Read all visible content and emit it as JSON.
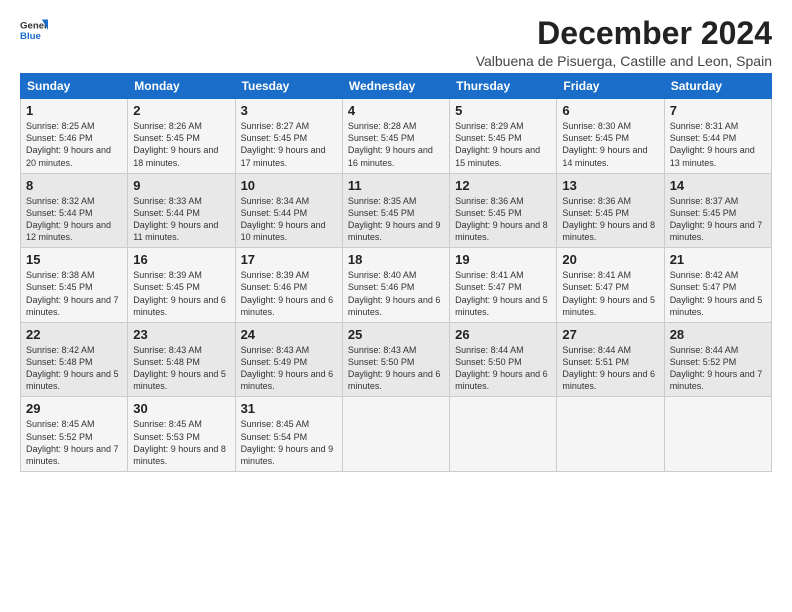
{
  "logo": {
    "general": "General",
    "blue": "Blue"
  },
  "title": "December 2024",
  "location": "Valbuena de Pisuerga, Castille and Leon, Spain",
  "weekdays": [
    "Sunday",
    "Monday",
    "Tuesday",
    "Wednesday",
    "Thursday",
    "Friday",
    "Saturday"
  ],
  "weeks": [
    [
      {
        "day": "1",
        "sunrise": "8:25 AM",
        "sunset": "5:46 PM",
        "daylight": "9 hours and 20 minutes."
      },
      {
        "day": "2",
        "sunrise": "8:26 AM",
        "sunset": "5:45 PM",
        "daylight": "9 hours and 18 minutes."
      },
      {
        "day": "3",
        "sunrise": "8:27 AM",
        "sunset": "5:45 PM",
        "daylight": "9 hours and 17 minutes."
      },
      {
        "day": "4",
        "sunrise": "8:28 AM",
        "sunset": "5:45 PM",
        "daylight": "9 hours and 16 minutes."
      },
      {
        "day": "5",
        "sunrise": "8:29 AM",
        "sunset": "5:45 PM",
        "daylight": "9 hours and 15 minutes."
      },
      {
        "day": "6",
        "sunrise": "8:30 AM",
        "sunset": "5:45 PM",
        "daylight": "9 hours and 14 minutes."
      },
      {
        "day": "7",
        "sunrise": "8:31 AM",
        "sunset": "5:44 PM",
        "daylight": "9 hours and 13 minutes."
      }
    ],
    [
      {
        "day": "8",
        "sunrise": "8:32 AM",
        "sunset": "5:44 PM",
        "daylight": "9 hours and 12 minutes."
      },
      {
        "day": "9",
        "sunrise": "8:33 AM",
        "sunset": "5:44 PM",
        "daylight": "9 hours and 11 minutes."
      },
      {
        "day": "10",
        "sunrise": "8:34 AM",
        "sunset": "5:44 PM",
        "daylight": "9 hours and 10 minutes."
      },
      {
        "day": "11",
        "sunrise": "8:35 AM",
        "sunset": "5:45 PM",
        "daylight": "9 hours and 9 minutes."
      },
      {
        "day": "12",
        "sunrise": "8:36 AM",
        "sunset": "5:45 PM",
        "daylight": "9 hours and 8 minutes."
      },
      {
        "day": "13",
        "sunrise": "8:36 AM",
        "sunset": "5:45 PM",
        "daylight": "9 hours and 8 minutes."
      },
      {
        "day": "14",
        "sunrise": "8:37 AM",
        "sunset": "5:45 PM",
        "daylight": "9 hours and 7 minutes."
      }
    ],
    [
      {
        "day": "15",
        "sunrise": "8:38 AM",
        "sunset": "5:45 PM",
        "daylight": "9 hours and 7 minutes."
      },
      {
        "day": "16",
        "sunrise": "8:39 AM",
        "sunset": "5:45 PM",
        "daylight": "9 hours and 6 minutes."
      },
      {
        "day": "17",
        "sunrise": "8:39 AM",
        "sunset": "5:46 PM",
        "daylight": "9 hours and 6 minutes."
      },
      {
        "day": "18",
        "sunrise": "8:40 AM",
        "sunset": "5:46 PM",
        "daylight": "9 hours and 6 minutes."
      },
      {
        "day": "19",
        "sunrise": "8:41 AM",
        "sunset": "5:47 PM",
        "daylight": "9 hours and 5 minutes."
      },
      {
        "day": "20",
        "sunrise": "8:41 AM",
        "sunset": "5:47 PM",
        "daylight": "9 hours and 5 minutes."
      },
      {
        "day": "21",
        "sunrise": "8:42 AM",
        "sunset": "5:47 PM",
        "daylight": "9 hours and 5 minutes."
      }
    ],
    [
      {
        "day": "22",
        "sunrise": "8:42 AM",
        "sunset": "5:48 PM",
        "daylight": "9 hours and 5 minutes."
      },
      {
        "day": "23",
        "sunrise": "8:43 AM",
        "sunset": "5:48 PM",
        "daylight": "9 hours and 5 minutes."
      },
      {
        "day": "24",
        "sunrise": "8:43 AM",
        "sunset": "5:49 PM",
        "daylight": "9 hours and 6 minutes."
      },
      {
        "day": "25",
        "sunrise": "8:43 AM",
        "sunset": "5:50 PM",
        "daylight": "9 hours and 6 minutes."
      },
      {
        "day": "26",
        "sunrise": "8:44 AM",
        "sunset": "5:50 PM",
        "daylight": "9 hours and 6 minutes."
      },
      {
        "day": "27",
        "sunrise": "8:44 AM",
        "sunset": "5:51 PM",
        "daylight": "9 hours and 6 minutes."
      },
      {
        "day": "28",
        "sunrise": "8:44 AM",
        "sunset": "5:52 PM",
        "daylight": "9 hours and 7 minutes."
      }
    ],
    [
      {
        "day": "29",
        "sunrise": "8:45 AM",
        "sunset": "5:52 PM",
        "daylight": "9 hours and 7 minutes."
      },
      {
        "day": "30",
        "sunrise": "8:45 AM",
        "sunset": "5:53 PM",
        "daylight": "9 hours and 8 minutes."
      },
      {
        "day": "31",
        "sunrise": "8:45 AM",
        "sunset": "5:54 PM",
        "daylight": "9 hours and 9 minutes."
      },
      null,
      null,
      null,
      null
    ]
  ]
}
